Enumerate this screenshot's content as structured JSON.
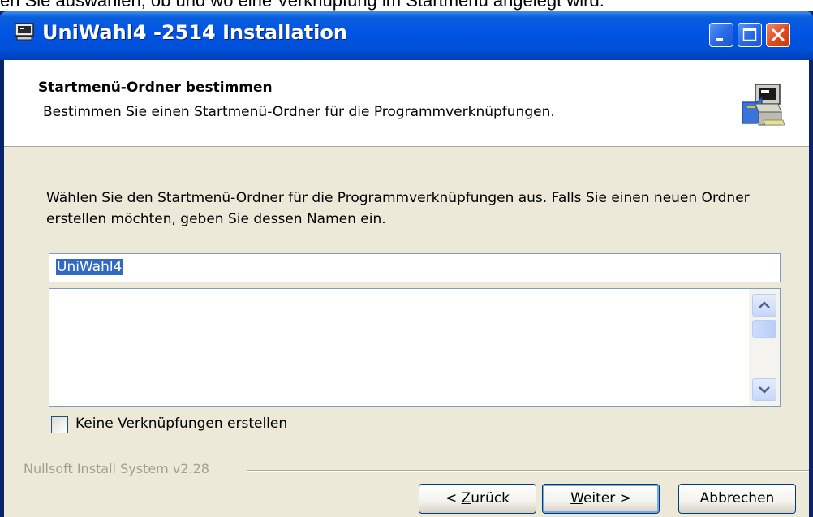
{
  "background_caption": "en Sie auswählen, ob und wo eine Verknüpfung im Startmenü angelegt wird.",
  "window": {
    "title": "UniWahl4 -2514 Installation",
    "controls": [
      "minimize",
      "maximize",
      "close"
    ]
  },
  "header": {
    "title": "Startmenü-Ordner bestimmen",
    "subtitle": "Bestimmen Sie einen Startmenü-Ordner für die Programmverknüpfungen."
  },
  "body": {
    "description": "Wählen Sie den Startmenü-Ordner für die Programmverknüpfungen aus. Falls Sie einen neuen Ordner erstellen möchten, geben Sie dessen Namen ein.",
    "folder_name": "UniWahl4",
    "folder_list": [],
    "no_shortcuts_label": "Keine Verknüpfungen erstellen",
    "no_shortcuts_checked": false
  },
  "footer": {
    "branding": "Nullsoft Install System v2.28",
    "back": {
      "prefix": "< ",
      "mnemonic": "Z",
      "rest": "urück"
    },
    "next": {
      "mnemonic": "W",
      "rest": "eiter >"
    },
    "cancel": "Abbrechen"
  },
  "colors": {
    "titlebar": "#0054e3",
    "dialog_bg": "#ece9d8",
    "selection": "#316ac5",
    "close_button": "#e0491e"
  }
}
